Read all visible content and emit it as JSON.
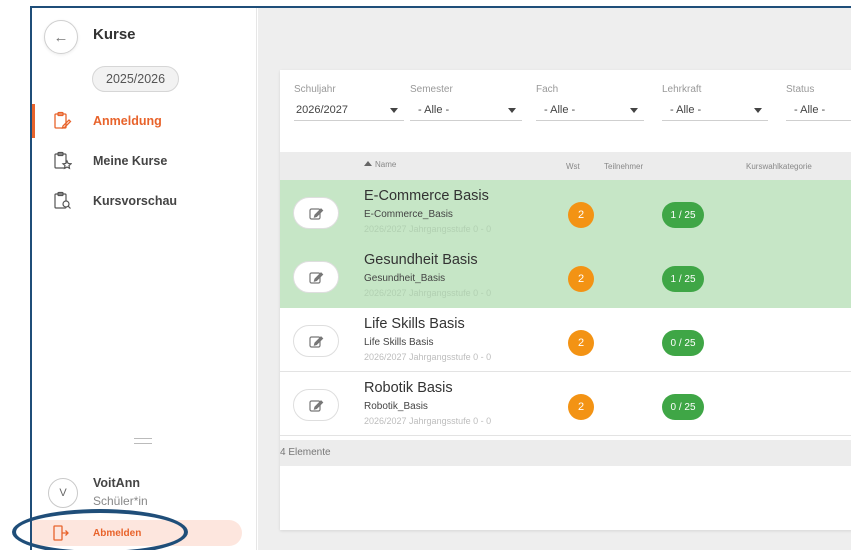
{
  "sidebar": {
    "title": "Kurse",
    "year": "2025/2026",
    "items": [
      {
        "label": "Anmeldung",
        "icon": "clipboard-pen-icon",
        "active": true
      },
      {
        "label": "Meine Kurse",
        "icon": "clipboard-star-icon",
        "active": false
      },
      {
        "label": "Kursvorschau",
        "icon": "clipboard-search-icon",
        "active": false
      }
    ],
    "user": {
      "initial": "V",
      "name": "VoitAnn",
      "role": "Schüler*in"
    },
    "logout_label": "Abmelden"
  },
  "filters": [
    {
      "label": "Schuljahr",
      "value": "2026/2027"
    },
    {
      "label": "Semester",
      "value": "- Alle -"
    },
    {
      "label": "Fach",
      "value": "- Alle -"
    },
    {
      "label": "Lehrkraft",
      "value": "- Alle -"
    },
    {
      "label": "Status",
      "value": "- Alle -"
    }
  ],
  "table": {
    "headers": {
      "name": "Name",
      "wst": "Wst",
      "participants": "Teilnehmer",
      "category": "Kurswahlkategorie"
    },
    "rows": [
      {
        "title": "E-Commerce Basis",
        "code": "E-Commerce_Basis",
        "sub": "2026/2027 Jahrgangsstufe 0 - 0",
        "wst": "2",
        "participants": "1 / 25",
        "enrolled": true
      },
      {
        "title": "Gesundheit Basis",
        "code": "Gesundheit_Basis",
        "sub": "2026/2027 Jahrgangsstufe 0 - 0",
        "wst": "2",
        "participants": "1 / 25",
        "enrolled": true
      },
      {
        "title": "Life Skills Basis",
        "code": "Life Skills Basis",
        "sub": "2026/2027 Jahrgangsstufe 0 - 0",
        "wst": "2",
        "participants": "0 / 25",
        "enrolled": false
      },
      {
        "title": "Robotik Basis",
        "code": "Robotik_Basis",
        "sub": "2026/2027 Jahrgangsstufe 0 - 0",
        "wst": "2",
        "participants": "0 / 25",
        "enrolled": false
      }
    ],
    "footer": "4 Elemente"
  },
  "colors": {
    "accent": "#e8632b",
    "enrolled_row": "#c6e6c6",
    "wst_badge": "#f39314",
    "participants_badge": "#3fa646",
    "highlight_ring": "#1f4e79"
  }
}
